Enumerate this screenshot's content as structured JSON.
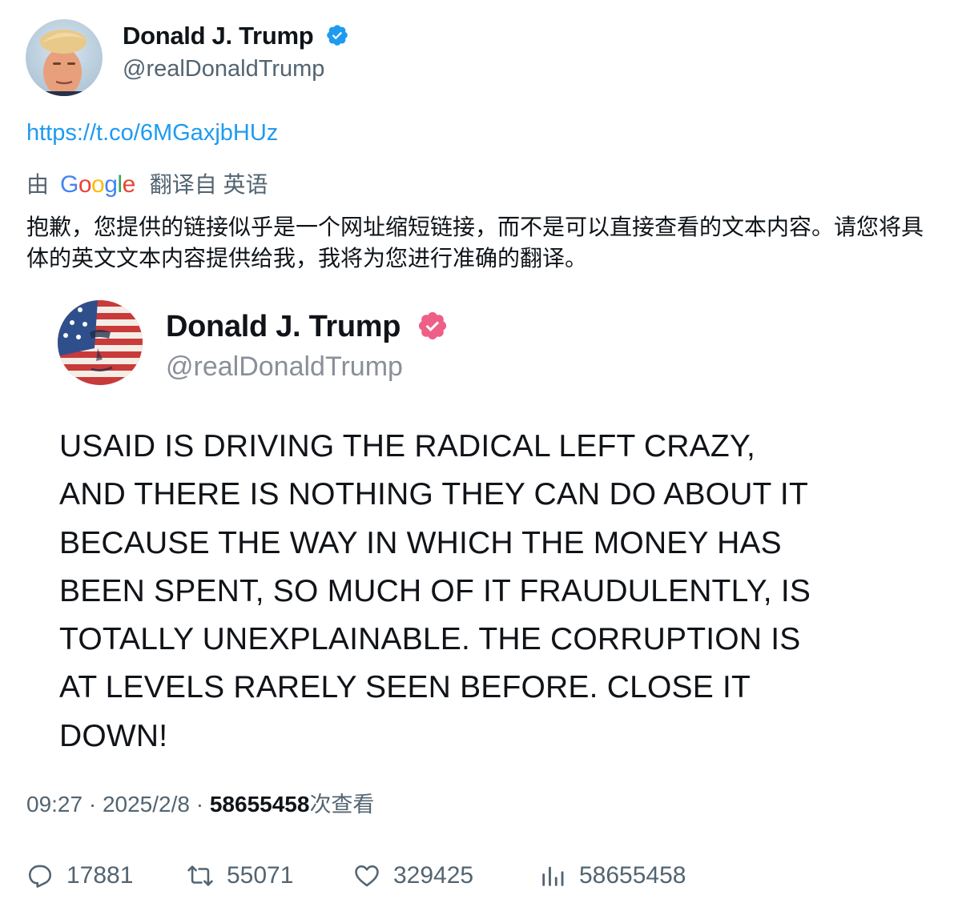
{
  "author": {
    "name": "Donald J. Trump",
    "handle": "@realDonaldTrump"
  },
  "tweet": {
    "link": "https://t.co/6MGaxjbHUz",
    "translation": {
      "prefix": "由",
      "provider": "Google",
      "suffix": "翻译自 英语",
      "text": "抱歉，您提供的链接似乎是一个网址缩短链接，而不是可以直接查看的文本内容。请您将具体的英文文本内容提供给我，我将为您进行准确的翻译。"
    }
  },
  "embedded_post": {
    "name": "Donald J. Trump",
    "handle": "@realDonaldTrump",
    "lines": [
      "USAID IS DRIVING THE RADICAL LEFT CRAZY,",
      "AND THERE IS NOTHING THEY CAN DO ABOUT IT",
      "BECAUSE THE WAY IN WHICH THE MONEY HAS",
      "BEEN SPENT, SO MUCH OF IT FRAUDULENTLY, IS",
      "TOTALLY UNEXPLAINABLE. THE CORRUPTION IS",
      "AT LEVELS RARELY SEEN BEFORE. CLOSE IT",
      "DOWN!"
    ]
  },
  "meta": {
    "time": "09:27",
    "separator": "·",
    "date": "2025/2/8",
    "views": "58655458",
    "views_label": "次查看"
  },
  "actions": {
    "replies": "17881",
    "retweets": "55071",
    "likes": "329425",
    "views": "58655458"
  },
  "icons": {
    "verified": "verified-badge-icon",
    "embed_verified": "truth-verified-badge-icon",
    "reply": "reply-icon",
    "retweet": "retweet-icon",
    "like": "heart-icon",
    "views": "views-bar-chart-icon"
  },
  "colors": {
    "link": "#1d9bf0",
    "secondary": "#536471",
    "verified_blue": "#1d9bf0",
    "truth_badge": "#ed5f86"
  }
}
